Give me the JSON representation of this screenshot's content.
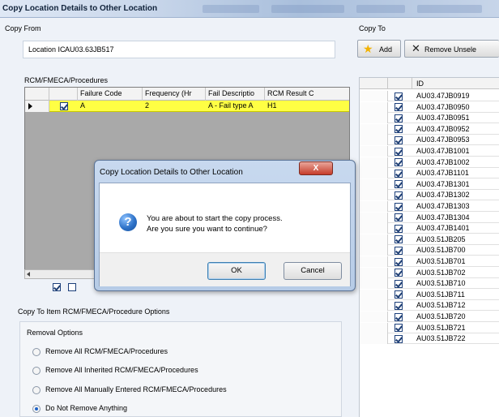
{
  "window": {
    "title": "Copy Location Details to Other Location"
  },
  "copy_from": {
    "label": "Copy From",
    "location_id_label": "Location IC",
    "location_id_value": "AU03.63JB517",
    "rcm_label": "RCM/FMECA/Procedures",
    "columns": [
      "Failure Code",
      "Frequency (Hr",
      "Fail Descriptio",
      "RCM Result C"
    ],
    "rows": [
      {
        "checked": true,
        "failure_code": "A",
        "frequency": "2",
        "fail_description": "A - Fail type A",
        "rcm_result": "H1"
      }
    ]
  },
  "options": {
    "label": "Copy To Item RCM/FMECA/Procedure Options",
    "removal_label": "Removal Options",
    "radios": [
      {
        "label": "Remove All RCM/FMECA/Procedures",
        "selected": false
      },
      {
        "label": "Remove All Inherited RCM/FMECA/Procedures",
        "selected": false
      },
      {
        "label": "Remove All Manually Entered RCM/FMECA/Procedures",
        "selected": false
      },
      {
        "label": "Do Not Remove Anything",
        "selected": true
      }
    ]
  },
  "copy_to": {
    "label": "Copy To",
    "add_label": "Add",
    "remove_label": "Remove Unsele",
    "id_column": "ID",
    "ids": [
      "AU03.47JB0919",
      "AU03.47JB0950",
      "AU03.47JB0951",
      "AU03.47JB0952",
      "AU03.47JB0953",
      "AU03.47JB1001",
      "AU03.47JB1002",
      "AU03.47JB1101",
      "AU03.47JB1301",
      "AU03.47JB1302",
      "AU03.47JB1303",
      "AU03.47JB1304",
      "AU03.47JB1401",
      "AU03.51JB205",
      "AU03.51JB700",
      "AU03.51JB701",
      "AU03.51JB702",
      "AU03.51JB710",
      "AU03.51JB711",
      "AU03.51JB712",
      "AU03.51JB720",
      "AU03.51JB721",
      "AU03.51JB722"
    ]
  },
  "dialog": {
    "title": "Copy Location Details to Other Location",
    "close_glyph": "X",
    "icon_glyph": "?",
    "message_line1": "You are about to start the copy process.",
    "message_line2": "Are you sure you want to continue?",
    "ok_label": "OK",
    "cancel_label": "Cancel"
  },
  "colors": {
    "highlight_row": "#ffff44",
    "dialog_frame": "#b6cbe6",
    "close_button": "#c63c2a"
  }
}
